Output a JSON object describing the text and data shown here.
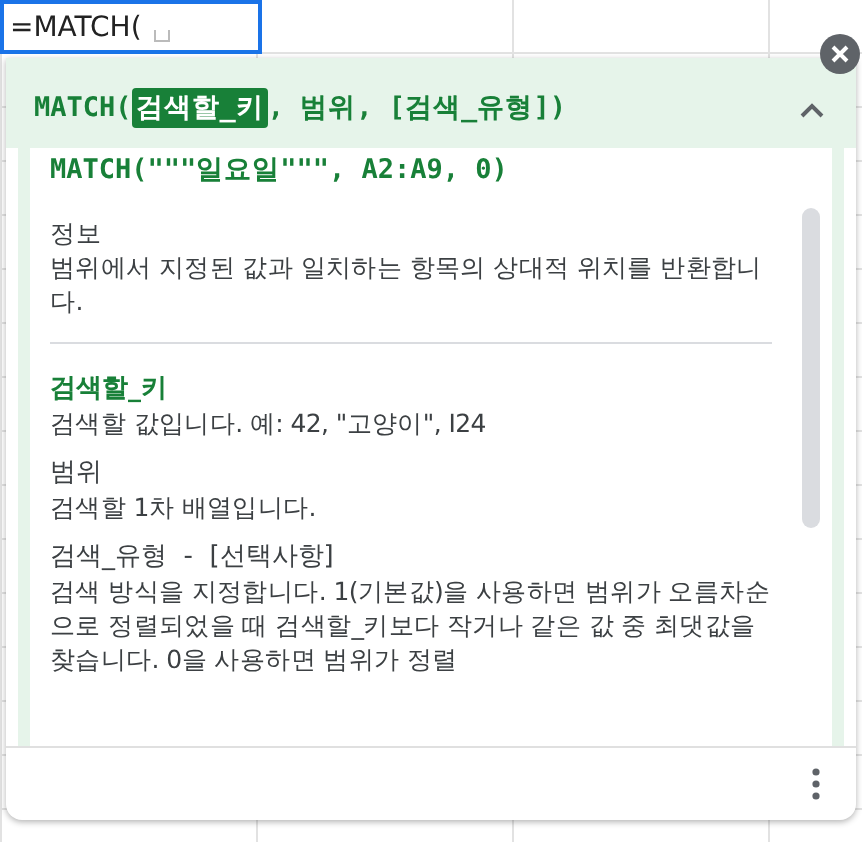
{
  "cell": {
    "value": "=MATCH("
  },
  "signature": [
    {
      "text": "MATCH(",
      "selected": false
    },
    {
      "text": "검색할_키",
      "selected": true
    },
    {
      "text": ", 범위, [검색_유형])",
      "selected": false
    }
  ],
  "expanded": true,
  "example": "MATCH(\"\"\"일요일\"\"\", A2:A9, 0)",
  "about": {
    "heading": "정보",
    "text": "범위에서 지정된 값과 일치하는 항목의 상대적 위치를 반환합니다."
  },
  "params": [
    {
      "name": "검색할_키",
      "selected": true,
      "text": "검색할 값입니다. 예: 42, \"고양이\", I24"
    },
    {
      "name": "범위",
      "selected": false,
      "text": "검색할 1차 배열입니다."
    },
    {
      "name": "검색_유형  -  [선택사항]",
      "selected": false,
      "text": "검색 방식을 지정합니다. 1(기본값)을 사용하면 범위가 오름차순으로 정렬되었을 때 검색할_키보다 작거나 같은 값 중 최댓값을 찾습니다. 0을 사용하면 범위가 정렬"
    }
  ]
}
